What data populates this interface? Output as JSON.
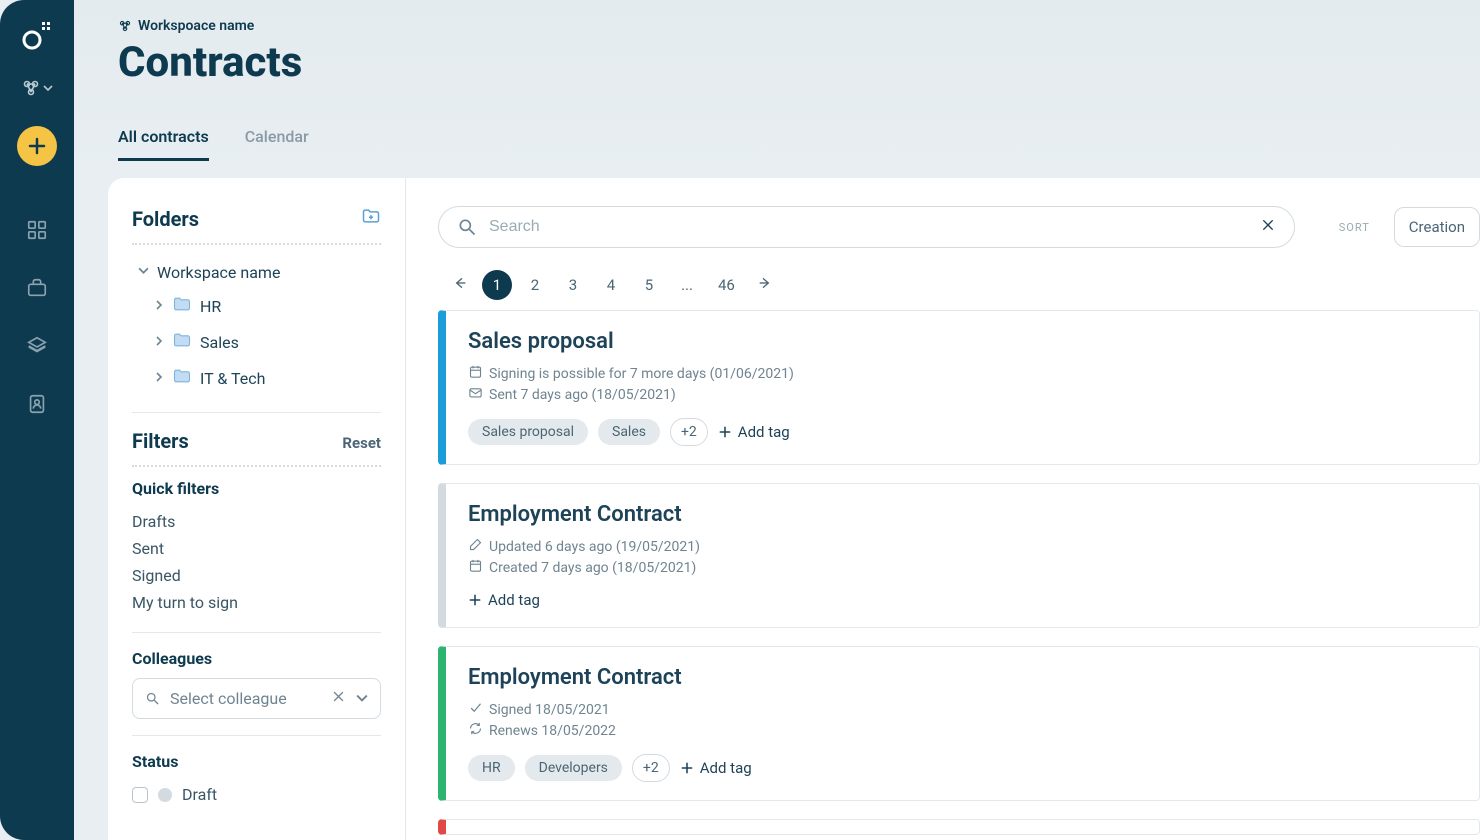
{
  "workspace_name": "Workspoace name",
  "page_title": "Contracts",
  "tabs": {
    "all_contracts": "All contracts",
    "calendar": "Calendar"
  },
  "sidebar": {
    "folders_title": "Folders",
    "root_name": "Workspace name",
    "folders": [
      {
        "label": "HR"
      },
      {
        "label": "Sales"
      },
      {
        "label": "IT & Tech"
      }
    ],
    "filters_title": "Filters",
    "reset_label": "Reset",
    "quick_filters_title": "Quick filters",
    "quick_filters": [
      {
        "label": "Drafts"
      },
      {
        "label": "Sent"
      },
      {
        "label": "Signed"
      },
      {
        "label": "My turn to sign"
      }
    ],
    "colleagues_title": "Colleagues",
    "colleague_placeholder": "Select colleague",
    "status_title": "Status",
    "statuses": [
      {
        "label": "Draft"
      }
    ]
  },
  "search": {
    "placeholder": "Search"
  },
  "sort_label": "SORT",
  "sort_value": "Creation",
  "pagination": {
    "pages": [
      "1",
      "2",
      "3",
      "4",
      "5",
      "...",
      "46"
    ],
    "active_index": 0
  },
  "contracts": [
    {
      "color": "blue",
      "title": "Sales proposal",
      "meta": [
        {
          "icon": "calendar",
          "text": "Signing is possible for 7 more days (01/06/2021)"
        },
        {
          "icon": "mail",
          "text": "Sent 7 days ago (18/05/2021)"
        }
      ],
      "tags": [
        "Sales proposal",
        "Sales"
      ],
      "more_tags": "+2",
      "add_tag_label": "Add tag"
    },
    {
      "color": "gray",
      "title": "Employment Contract",
      "meta": [
        {
          "icon": "edit",
          "text": "Updated 6 days ago (19/05/2021)"
        },
        {
          "icon": "calendar",
          "text": "Created 7 days ago (18/05/2021)"
        }
      ],
      "tags": [],
      "more_tags": "",
      "add_tag_label": "Add tag"
    },
    {
      "color": "green",
      "title": "Employment Contract",
      "meta": [
        {
          "icon": "check",
          "text": "Signed 18/05/2021"
        },
        {
          "icon": "refresh",
          "text": "Renews 18/05/2022"
        }
      ],
      "tags": [
        "HR",
        "Developers"
      ],
      "more_tags": "+2",
      "add_tag_label": "Add tag"
    },
    {
      "color": "red",
      "title": "",
      "meta": [],
      "tags": [],
      "more_tags": "",
      "add_tag_label": ""
    }
  ]
}
